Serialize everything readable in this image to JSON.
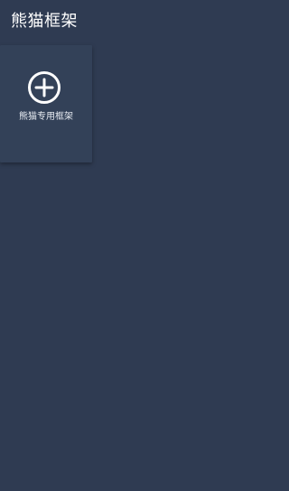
{
  "header": {
    "title": "熊猫框架"
  },
  "tiles": [
    {
      "label": "熊猫专用框架",
      "icon": "add-circle-icon"
    }
  ],
  "colors": {
    "background": "#2f3b52",
    "tile_background": "#334158",
    "text": "#ffffff"
  }
}
